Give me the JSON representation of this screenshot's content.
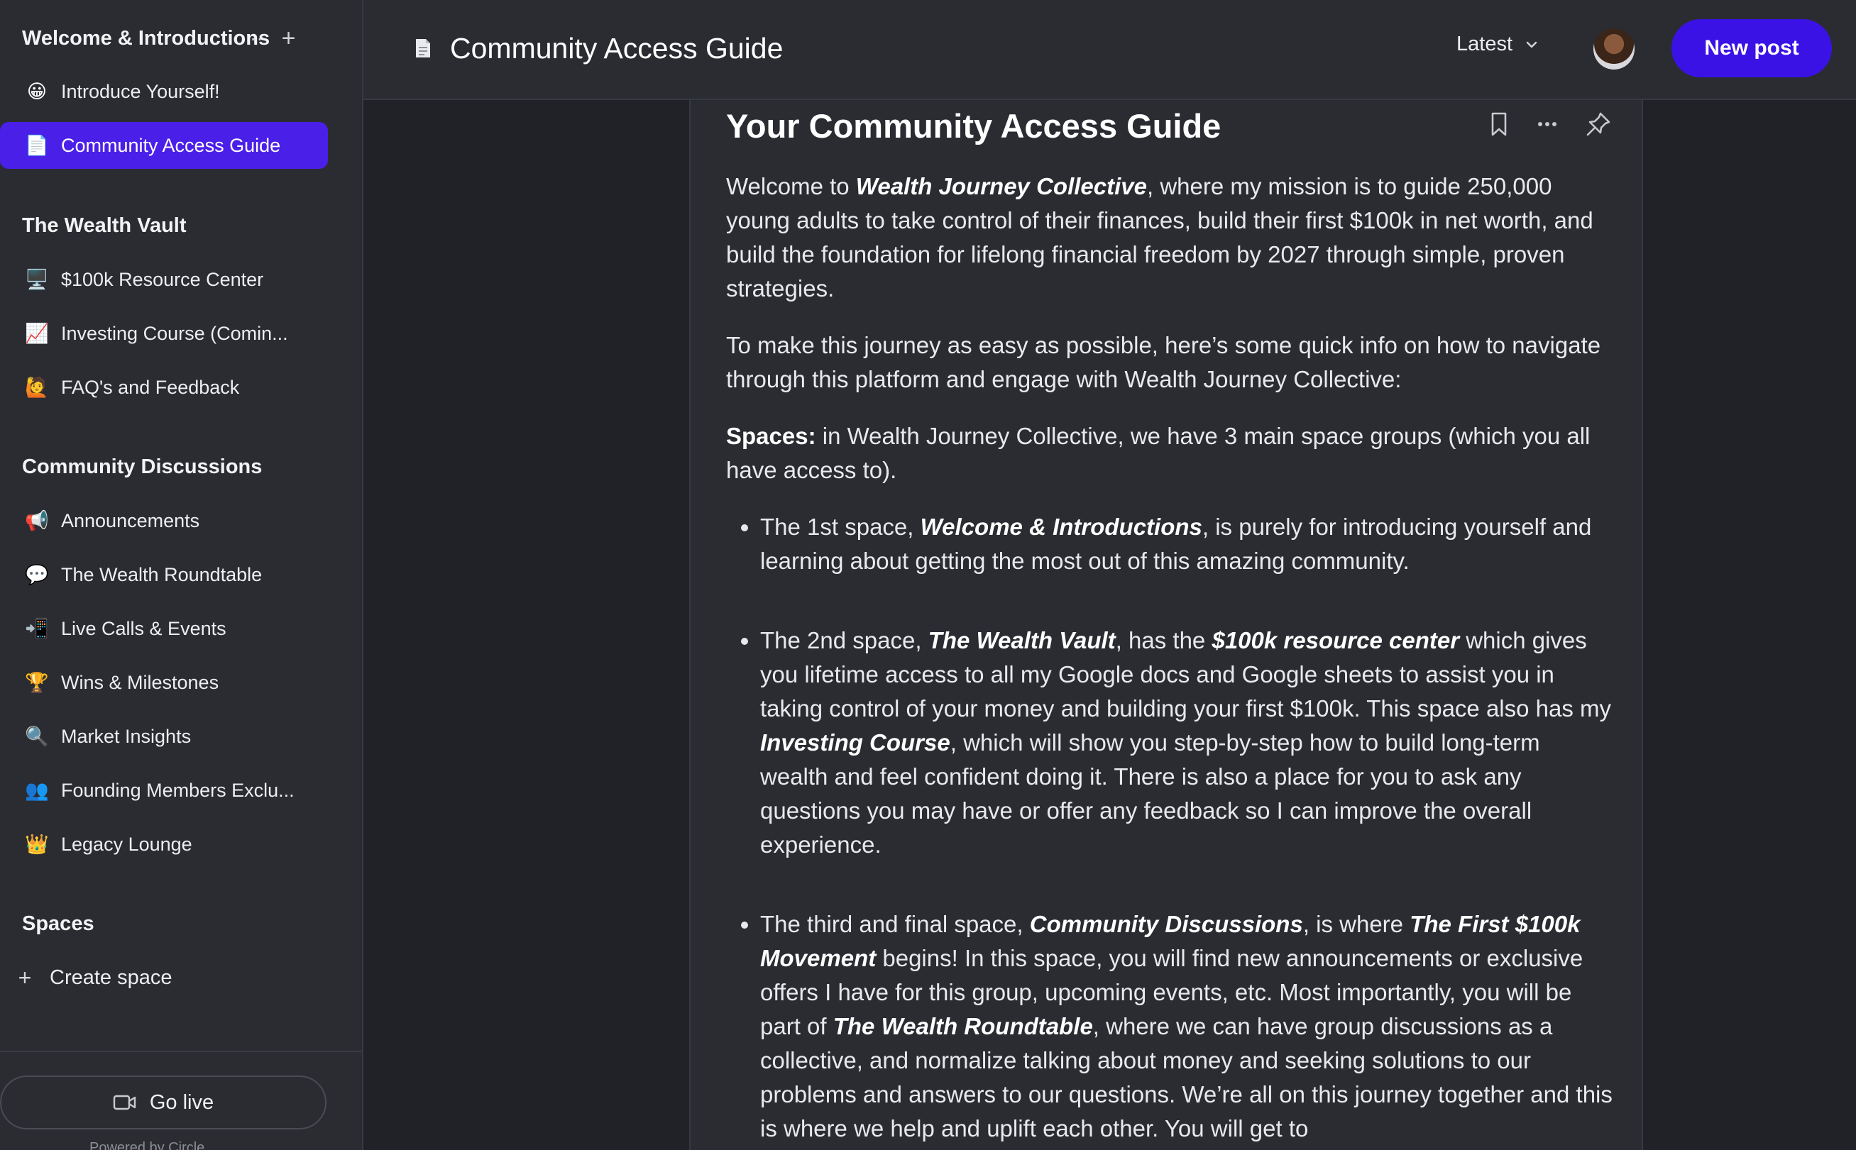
{
  "sidebar": {
    "welcome_group": {
      "title": "Welcome & Introductions",
      "items": [
        {
          "emoji": "😀",
          "label": "Introduce Yourself!"
        },
        {
          "emoji": "📄",
          "label": "Community Access Guide"
        }
      ]
    },
    "vault_group": {
      "title": "The Wealth Vault",
      "items": [
        {
          "emoji": "🖥️",
          "label": "$100k Resource Center"
        },
        {
          "emoji": "📈",
          "label": "Investing Course (Comin..."
        },
        {
          "emoji": "🙋",
          "label": "FAQ's and Feedback"
        }
      ]
    },
    "discussions_group": {
      "title": "Community Discussions",
      "items": [
        {
          "emoji": "📢",
          "label": "Announcements"
        },
        {
          "emoji": "💬",
          "label": "The Wealth Roundtable"
        },
        {
          "emoji": "📲",
          "label": "Live Calls & Events"
        },
        {
          "emoji": "🏆",
          "label": "Wins & Milestones"
        },
        {
          "emoji": "🔍",
          "label": "Market Insights"
        },
        {
          "emoji": "👥",
          "label": "Founding Members Exclu..."
        },
        {
          "emoji": "👑",
          "label": "Legacy Lounge"
        }
      ]
    },
    "spaces_group": {
      "title": "Spaces",
      "create_label": "Create space"
    },
    "go_live_label": "Go live",
    "powered_by": "Powered by Circle"
  },
  "header": {
    "title": "Community Access Guide",
    "sort_label": "Latest",
    "new_post_label": "New post"
  },
  "post": {
    "title": "Your Community Access Guide",
    "p1": {
      "a": "Welcome to ",
      "b": "Wealth Journey Collective",
      "c": ", where my mission is to guide 250,000 young adults to take control of their finances, build their first $100k in net worth, and build the foundation for lifelong financial freedom by 2027 through simple, proven strategies."
    },
    "p2": "To make this journey as easy as possible, here’s some quick info on how to navigate through this platform and engage with Wealth Journey Collective:",
    "p3": {
      "a": "Spaces:",
      "b": " in Wealth Journey Collective, we have 3 main space groups (which you all have access to)."
    },
    "li1": {
      "a": "The 1st space, ",
      "b": "Welcome & Introductions",
      "c": ", is purely for introducing yourself and learning about getting the most out of this amazing community."
    },
    "li2": {
      "a": "The 2nd space, ",
      "b": "The Wealth Vault",
      "c": ", has the ",
      "d": "$100k resource center",
      "e": " which gives you lifetime access to all my Google docs and Google sheets to assist you in taking control of your money and building your first $100k. This space also has my ",
      "f": "Investing Course",
      "g": ", which will show you step-by-step how to build long-term wealth and feel confident doing it. There is also a place for you to ask any questions you may have or offer any feedback so I can improve the overall experience."
    },
    "li3": {
      "a": "The third and final space, ",
      "b": "Community Discussions",
      "c": ", is where ",
      "d": "The First $100k Movement",
      "e": " begins! In this space, you will find new announcements or exclusive offers I have for this group, upcoming events, etc. Most importantly, you will be part of ",
      "f": "The Wealth Roundtable",
      "g": ", where we can have group discussions as a collective, and normalize talking about money and seeking solutions to our problems and answers to our questions. We’re all on this journey together and this is where we help and uplift each other. You will get to"
    }
  },
  "colors": {
    "accent": "#4a1fe8",
    "button": "#3a12e6",
    "background": "#202227",
    "panel": "#2a2c32"
  }
}
